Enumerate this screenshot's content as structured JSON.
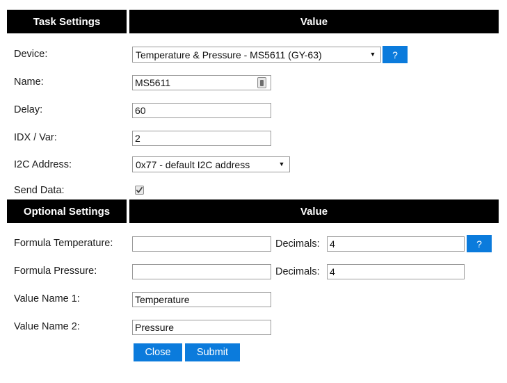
{
  "task_section": {
    "header": {
      "left": "Task Settings",
      "right": "Value"
    },
    "rows": [
      {
        "label": "Device:",
        "control": "select",
        "value": "Temperature & Pressure - MS5611 (GY-63)",
        "help": "?"
      },
      {
        "label": "Name:",
        "control": "text",
        "value": "MS5611",
        "icon": "form-autofill-icon"
      },
      {
        "label": "Delay:",
        "control": "text",
        "value": "60"
      },
      {
        "label": "IDX / Var:",
        "control": "text",
        "value": "2"
      },
      {
        "label": "I2C Address:",
        "control": "select",
        "value": "0x77 - default I2C address"
      },
      {
        "label": "Send Data:",
        "control": "checkbox",
        "checked": true
      }
    ]
  },
  "optional_section": {
    "header": {
      "left": "Optional Settings",
      "right": "Value"
    },
    "rows": [
      {
        "label": "Formula Temperature:",
        "value": "",
        "decimals_label": "Decimals:",
        "decimals_value": "4",
        "help": "?"
      },
      {
        "label": "Formula Pressure:",
        "value": "",
        "decimals_label": "Decimals:",
        "decimals_value": "4"
      },
      {
        "label": "Value Name 1:",
        "value": "Temperature"
      },
      {
        "label": "Value Name 2:",
        "value": "Pressure"
      }
    ]
  },
  "actions": {
    "close": "Close",
    "submit": "Submit"
  },
  "colors": {
    "accent_blue": "#0b7bdc",
    "header_black": "#000000",
    "border_gray": "#9a9a9a"
  }
}
